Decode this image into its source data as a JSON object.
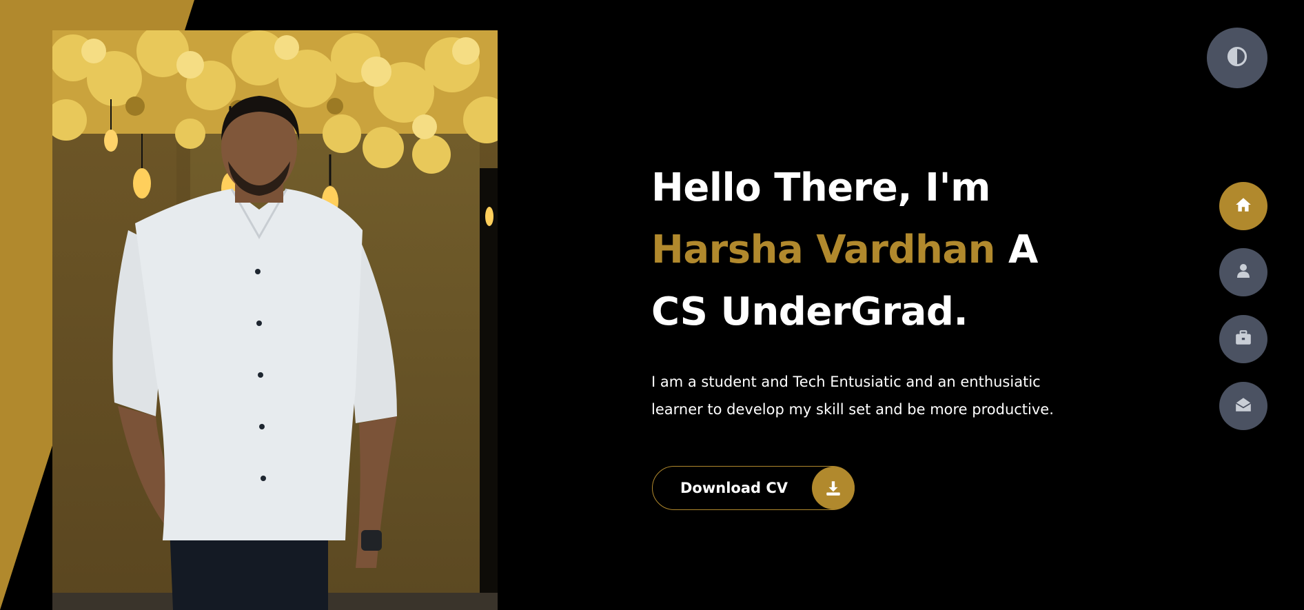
{
  "hero": {
    "greeting": "Hello There, I'm",
    "name": "Harsha Vardhan",
    "name_suffix": " A",
    "role": "CS UnderGrad.",
    "description": "I am a student and Tech Entusiatic and an enthusiatic learner to develop my skill set and be more productive."
  },
  "cta": {
    "download_label": "Download CV",
    "icon": "download-icon"
  },
  "theme_toggle": {
    "icon": "contrast-icon"
  },
  "nav": {
    "items": [
      {
        "icon": "home-icon",
        "active": true
      },
      {
        "icon": "user-icon",
        "active": false
      },
      {
        "icon": "briefcase-icon",
        "active": false
      },
      {
        "icon": "mail-open-icon",
        "active": false
      }
    ]
  },
  "colors": {
    "accent": "#b1892d",
    "background": "#000000",
    "nav_inactive": "#4b5262",
    "text": "#ffffff"
  }
}
